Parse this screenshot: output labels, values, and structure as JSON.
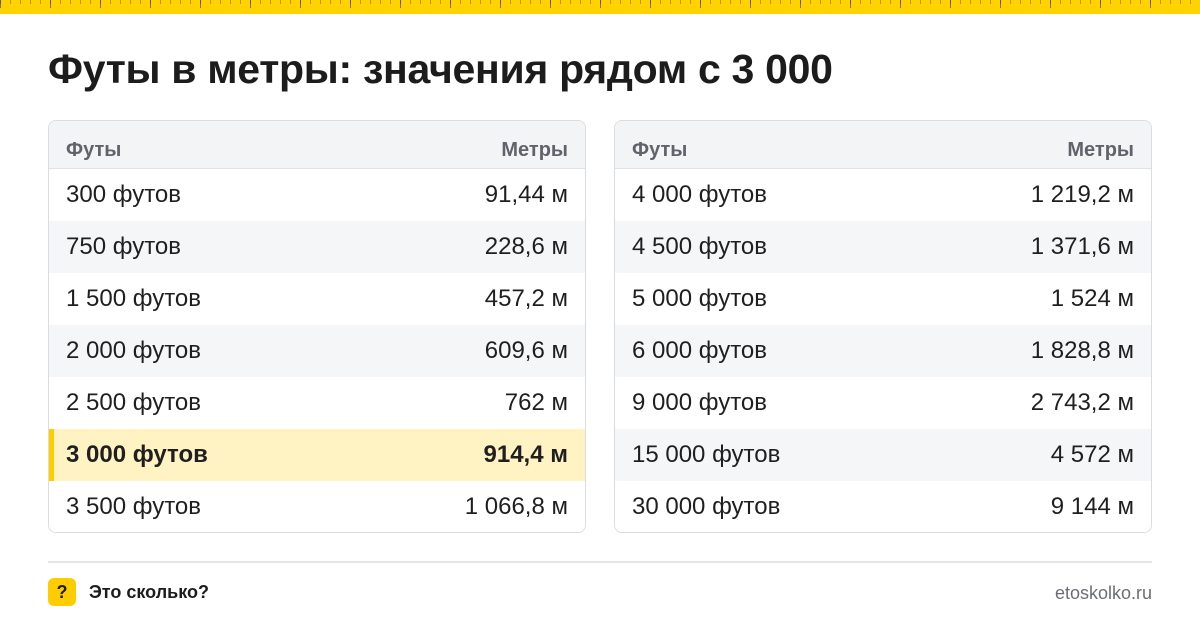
{
  "title": "Футы в метры: значения рядом с 3 000",
  "left_table": {
    "headers": [
      "Футы",
      "Метры"
    ],
    "rows": [
      [
        "300 футов",
        "91,44 м"
      ],
      [
        "750 футов",
        "228,6 м"
      ],
      [
        "1 500 футов",
        "457,2 м"
      ],
      [
        "2 000 футов",
        "609,6 м"
      ],
      [
        "2 500 футов",
        "762 м"
      ],
      [
        "3 000 футов",
        "914,4 м"
      ],
      [
        "3 500 футов",
        "1 066,8 м"
      ]
    ]
  },
  "right_table": {
    "headers": [
      "Футы",
      "Метры"
    ],
    "rows": [
      [
        "4 000 футов",
        "1 219,2 м"
      ],
      [
        "4 500 футов",
        "1 371,6 м"
      ],
      [
        "5 000 футов",
        "1 524 м"
      ],
      [
        "6 000 футов",
        "1 828,8 м"
      ],
      [
        "9 000 футов",
        "2 743,2 м"
      ],
      [
        "15 000 футов",
        "4 572 м"
      ],
      [
        "30 000 футов",
        "9 144 м"
      ]
    ]
  },
  "footer": {
    "logo_glyph": "?",
    "brand": "Это сколько?",
    "site": "etoskolko.ru"
  },
  "colors": {
    "accent": "#ffcc00",
    "highlight_row": "#fff3c4"
  }
}
